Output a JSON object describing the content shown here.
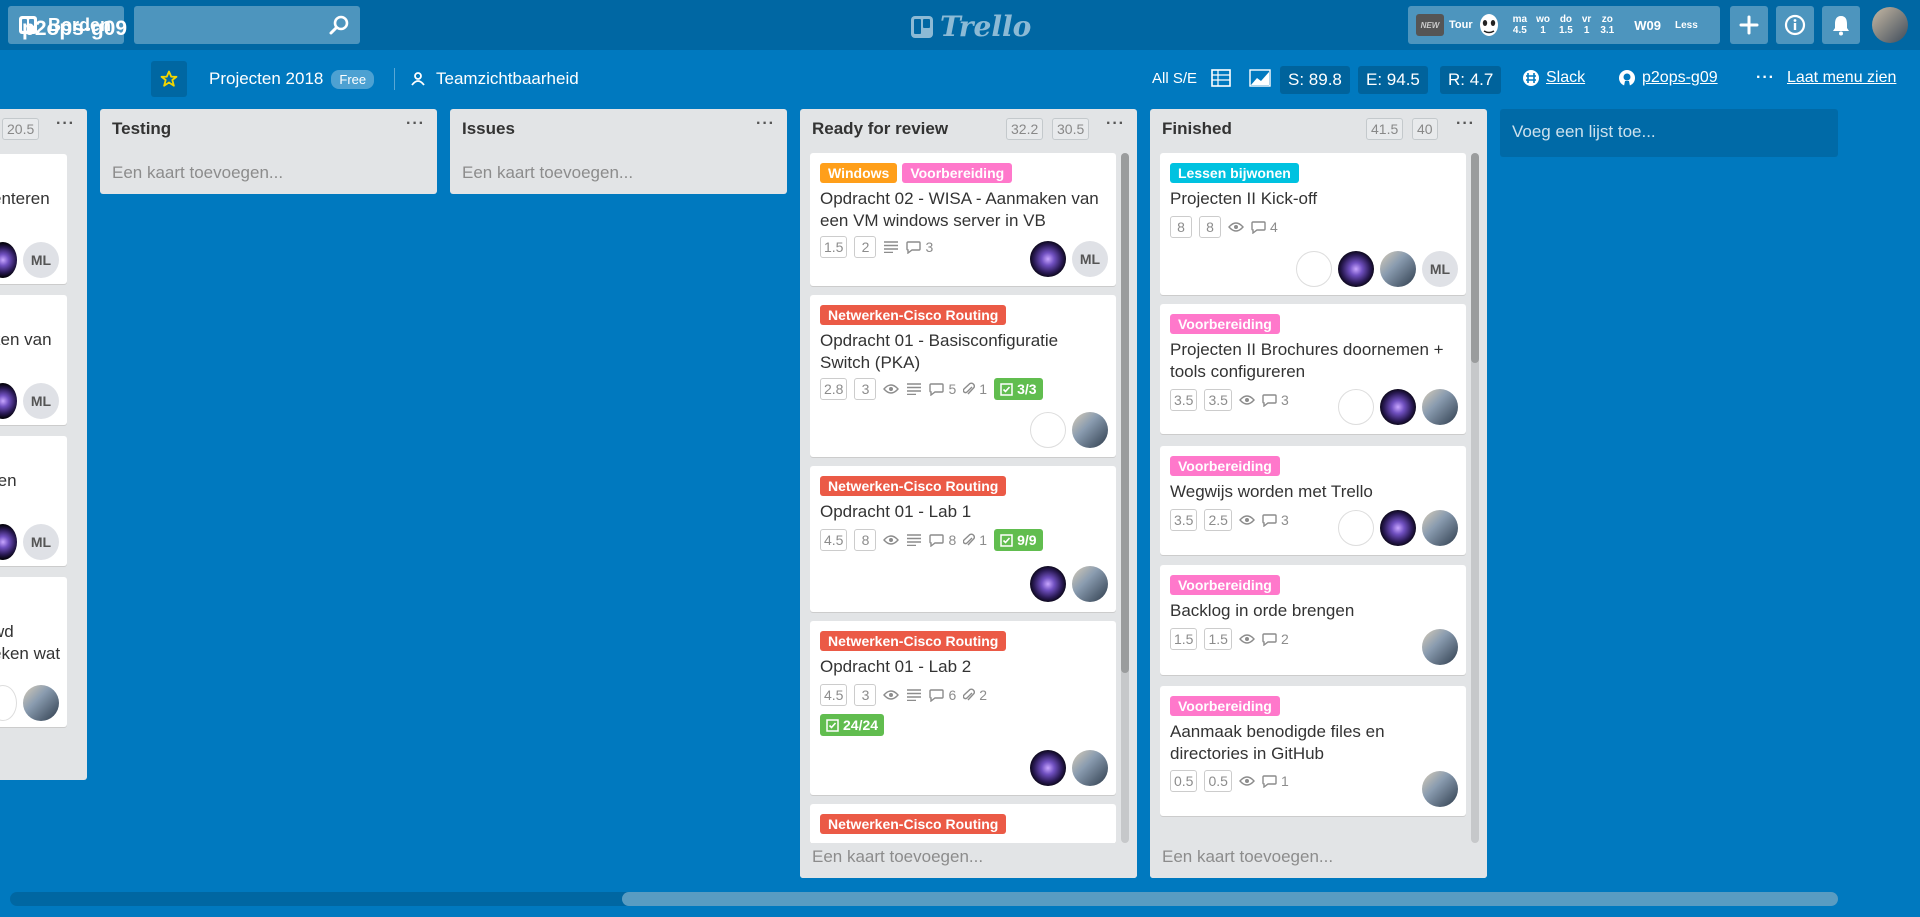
{
  "topbar": {
    "boards_label": "Borden",
    "logo_text": "Trello",
    "new_badge": "NEW",
    "tour_label": "Tour",
    "days": [
      {
        "d": "ma",
        "v": "4.5"
      },
      {
        "d": "wo",
        "v": "1"
      },
      {
        "d": "do",
        "v": "1.5"
      },
      {
        "d": "vr",
        "v": "1"
      },
      {
        "d": "zo",
        "v": "3.1"
      }
    ],
    "week_label": "W09",
    "less_label": "Less"
  },
  "board": {
    "title": "p2ops-g09",
    "org": "Projecten 2018",
    "org_badge": "Free",
    "visibility": "Teamzichtbaarheid",
    "all_se": "All S/E",
    "s_value": "S: 89.8",
    "e_value": "E: 94.5",
    "r_value": "R: 4.7",
    "slack": "Slack",
    "github": "p2ops-g09",
    "menu": "Laat menu zien",
    "add_list": "Voeg een lijst toe..."
  },
  "lists": {
    "partial": {
      "badge": "20.5",
      "cards": [
        {
          "title_1": "enteren",
          "title_2": ""
        },
        {
          "title_1": "ken van",
          "title_2": ""
        },
        {
          "title_1": "ren",
          "title_2": ""
        },
        {
          "title_1": "wd",
          "title_2": "eken wat"
        }
      ]
    },
    "testing": {
      "title": "Testing",
      "add": "Een kaart toevoegen..."
    },
    "issues": {
      "title": "Issues",
      "add": "Een kaart toevoegen..."
    },
    "ready": {
      "title": "Ready for review",
      "b1": "32.2",
      "b2": "30.5",
      "add": "Een kaart toevoegen...",
      "cards": [
        {
          "labels": [
            "Windows",
            "Voorbereiding"
          ],
          "title_1": "Opdracht 02 - WISA - Aanmaken van",
          "title_2": "een VM windows server in VB",
          "p1": "1.5",
          "p2": "2",
          "comments": "3"
        },
        {
          "labels": [
            "Netwerken-Cisco Routing"
          ],
          "title_1": "Opdracht 01 - Basisconfiguratie",
          "title_2": "Switch (PKA)",
          "p1": "2.8",
          "p2": "3",
          "comments": "5",
          "attach": "1",
          "check": "3/3"
        },
        {
          "labels": [
            "Netwerken-Cisco Routing"
          ],
          "title_1": "Opdracht 01 - Lab 1",
          "p1": "4.5",
          "p2": "8",
          "comments": "8",
          "attach": "1",
          "check": "9/9"
        },
        {
          "labels": [
            "Netwerken-Cisco Routing"
          ],
          "title_1": "Opdracht 01 - Lab 2",
          "p1": "4.5",
          "p2": "3",
          "comments": "6",
          "attach": "2",
          "check": "24/24"
        },
        {
          "labels": [
            "Netwerken-Cisco Routing"
          ]
        }
      ]
    },
    "finished": {
      "title": "Finished",
      "b1": "41.5",
      "b2": "40",
      "add": "Een kaart toevoegen...",
      "cards": [
        {
          "labels": [
            "Lessen bijwonen"
          ],
          "title_1": "Projecten II Kick-off",
          "p1": "8",
          "p2": "8",
          "comments": "4"
        },
        {
          "labels": [
            "Voorbereiding"
          ],
          "title_1": "Projecten II Brochures doornemen +",
          "title_2": "tools configureren",
          "p1": "3.5",
          "p2": "3.5",
          "comments": "3"
        },
        {
          "labels": [
            "Voorbereiding"
          ],
          "title_1": "Wegwijs worden met Trello",
          "p1": "3.5",
          "p2": "2.5",
          "comments": "3"
        },
        {
          "labels": [
            "Voorbereiding"
          ],
          "title_1": "Backlog in orde brengen",
          "p1": "1.5",
          "p2": "1.5",
          "comments": "2"
        },
        {
          "labels": [
            "Voorbereiding"
          ],
          "title_1": "Aanmaak benodigde files en",
          "title_2": "directories in GitHub",
          "p1": "0.5",
          "p2": "0.5",
          "comments": "1"
        }
      ]
    }
  },
  "avatar_initials": "ML",
  "colors": {
    "board_bg": "#0079bf",
    "label_windows": "#ff9f1a",
    "label_voorbereiding": "#ff78cb",
    "label_netwerken": "#eb5a46",
    "label_lessen": "#00c2e0",
    "checklist_done": "#61bd4f"
  }
}
